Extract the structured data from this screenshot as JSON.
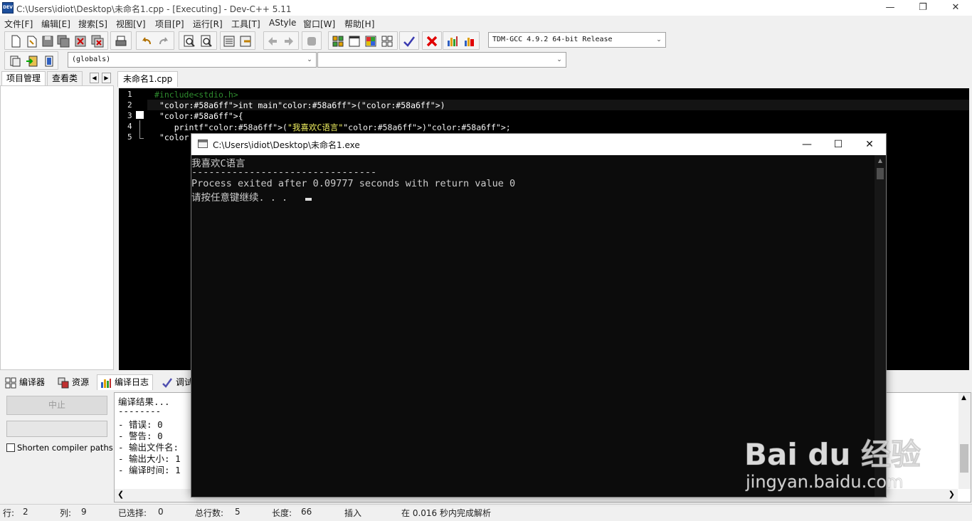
{
  "window": {
    "title": "C:\\Users\\idiot\\Desktop\\未命名1.cpp - [Executing] - Dev-C++ 5.11",
    "app_icon_text": "DEV"
  },
  "menu": [
    "文件[F]",
    "编辑[E]",
    "搜索[S]",
    "视图[V]",
    "项目[P]",
    "运行[R]",
    "工具[T]",
    "AStyle",
    "窗口[W]",
    "帮助[H]"
  ],
  "toolbar": {
    "compiler_select": "TDM-GCC 4.9.2 64-bit Release",
    "scope_select": "(globals)",
    "member_select": ""
  },
  "left_tabs": [
    "项目管理",
    "查看类"
  ],
  "editor": {
    "file_tab": "未命名1.cpp",
    "line_numbers": [
      "1",
      "2",
      "3",
      "4",
      "5"
    ],
    "lines": [
      {
        "text": "#include<stdio.h>",
        "color": "#2e8b2e"
      },
      {
        "text": " int main()",
        "color": "#ffffff"
      },
      {
        "text": " {",
        "color": "#ffffff"
      },
      {
        "text": "    printf(\"我喜欢C语言\");",
        "color": "#ffffff"
      },
      {
        "text": " }",
        "color": "#ffffff"
      }
    ],
    "colors": {
      "keyword": "#58a6ff",
      "string": "#ffff66",
      "preprocessor": "#2e8b2e",
      "background": "#000000"
    }
  },
  "bottom_tabs": [
    "编译器",
    "资源",
    "编译日志",
    "调试"
  ],
  "bottom_panel": {
    "abort_label": "中止",
    "shorten_label": "Shorten compiler paths",
    "log": [
      "编译结果...",
      "--------",
      "- 错误: 0",
      "- 警告: 0",
      "- 输出文件名: ",
      "- 输出大小: 1",
      "- 编译时间: 1"
    ]
  },
  "status": {
    "row_label": "行:",
    "row_value": "2",
    "col_label": "列:",
    "col_value": "9",
    "sel_label": "已选择:",
    "sel_value": "0",
    "total_label": "总行数:",
    "total_value": "5",
    "len_label": "长度:",
    "len_value": "66",
    "mode": "插入",
    "parse_msg": "在 0.016 秒内完成解析"
  },
  "console": {
    "title": "C:\\Users\\idiot\\Desktop\\未命名1.exe",
    "lines": [
      "我喜欢C语言",
      "--------------------------------",
      "Process exited after 0.09777 seconds with return value 0",
      "请按任意键继续. . . "
    ]
  },
  "watermark": {
    "brand": "Bai du 经验",
    "url": "jingyan.baidu.com"
  }
}
